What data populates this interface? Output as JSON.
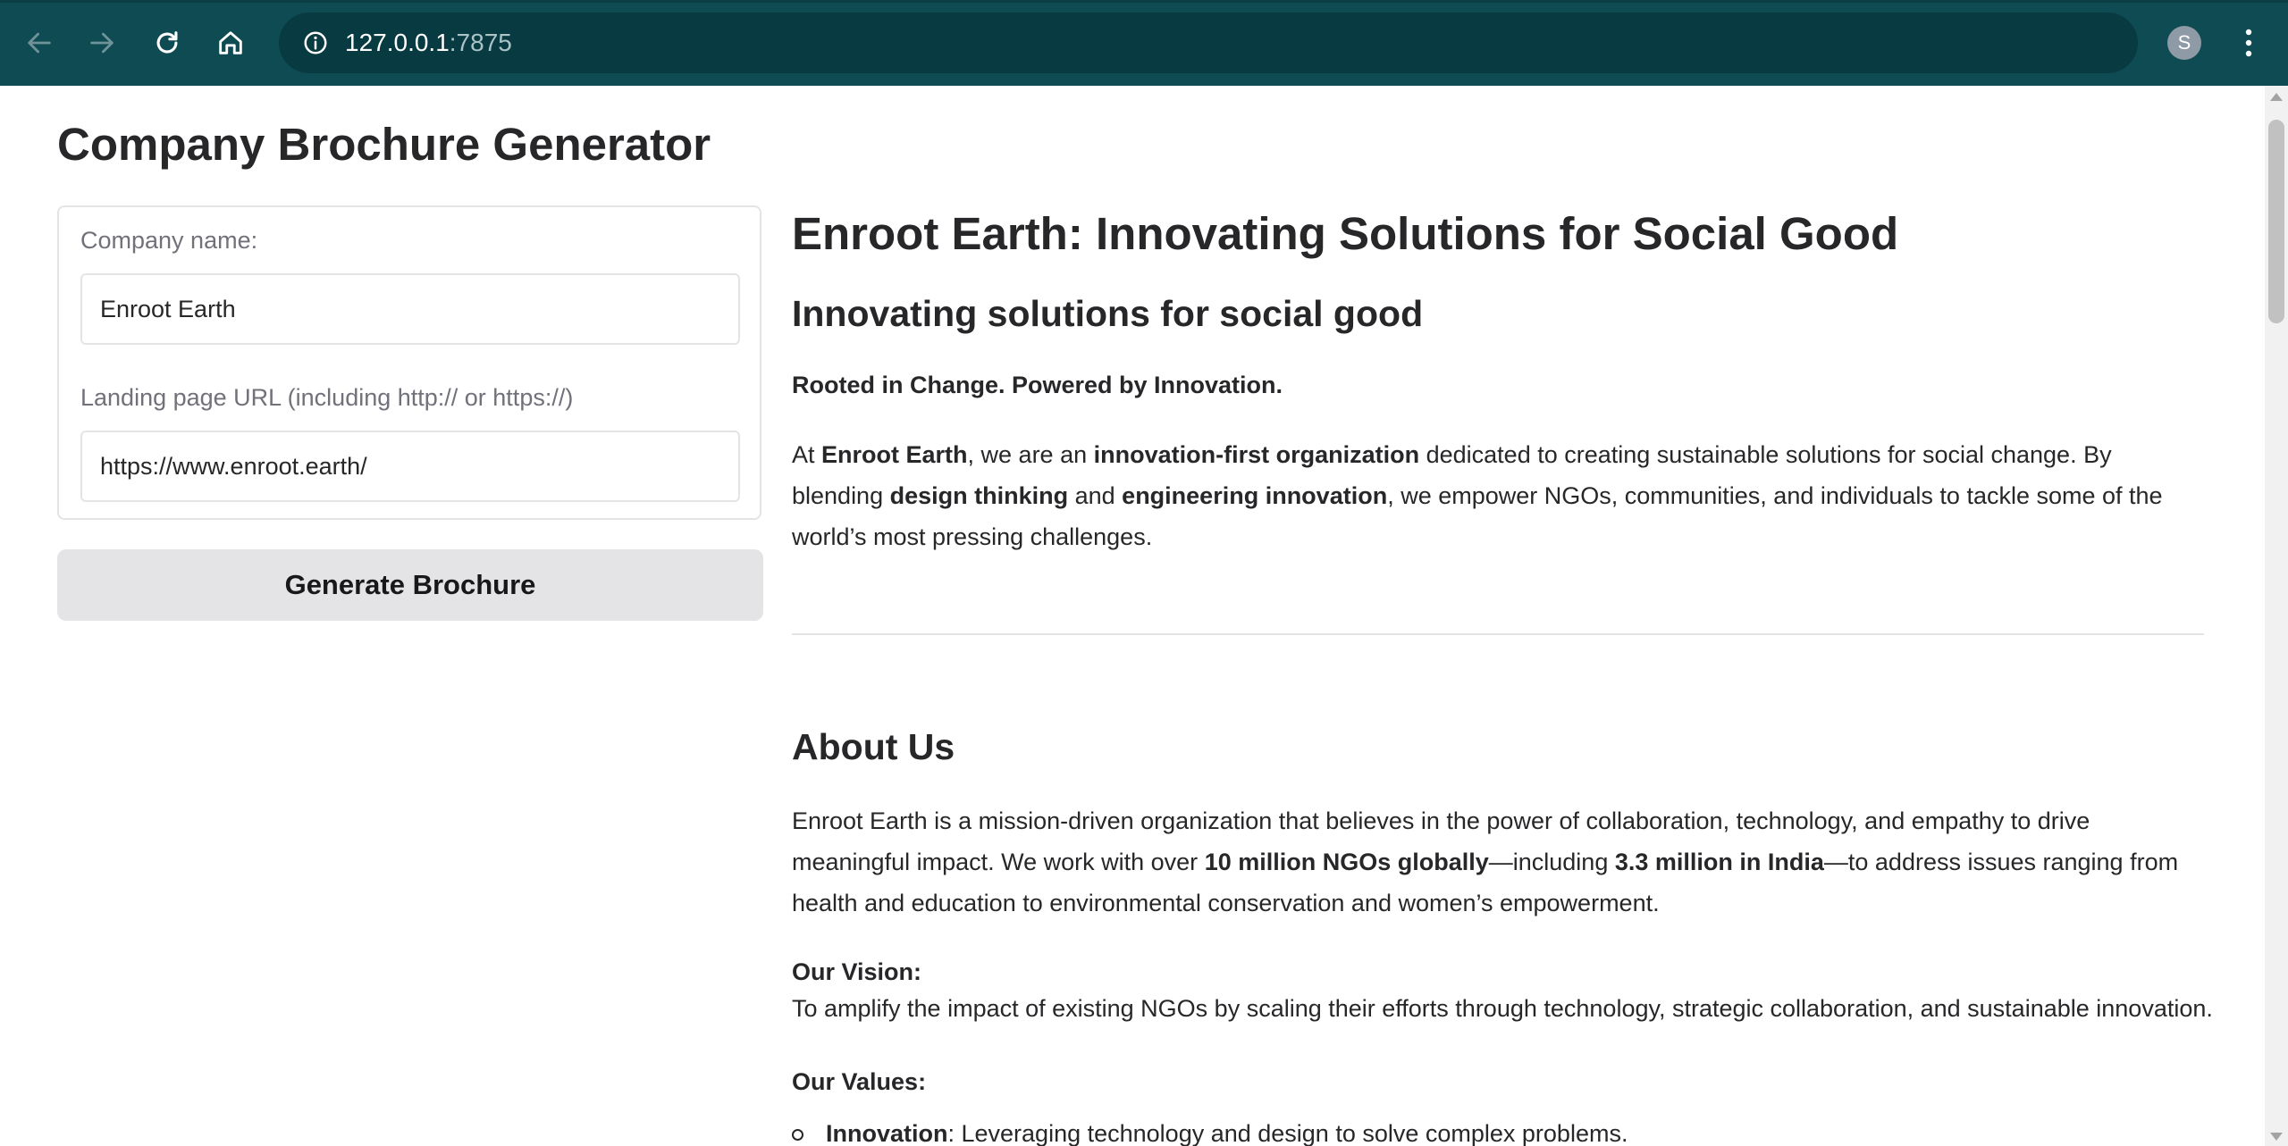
{
  "browser": {
    "url_host": "127.0.0.1",
    "url_port": ":7875",
    "profile_initial": "S",
    "colors": {
      "chrome": "#0e4b53",
      "omnibox": "#083a41"
    },
    "icons": [
      "back-arrow-icon",
      "forward-arrow-icon",
      "reload-icon",
      "home-icon",
      "site-info-icon",
      "bookmark-star-icon",
      "kebab-menu-icon"
    ]
  },
  "app": {
    "title": "Company Brochure Generator",
    "company_name_label": "Company name:",
    "company_name_value": "Enroot Earth",
    "url_label": "Landing page URL (including http:// or https://)",
    "url_value": "https://www.enroot.earth/",
    "generate_button": "Generate Brochure"
  },
  "brochure": {
    "h1": "Enroot Earth: Innovating Solutions for Social Good",
    "h2": "Innovating solutions for social good",
    "tagline": "Rooted in Change. Powered by Innovation.",
    "intro": {
      "t1": "At ",
      "b1": "Enroot Earth",
      "t2": ", we are an ",
      "b2": "innovation-first organization",
      "t3": " dedicated to creating sustainable solutions for social change. By blending ",
      "b3": "design thinking",
      "t4": " and ",
      "b4": "engineering innovation",
      "t5": ", we empower NGOs, communities, and individuals to tackle some of the world’s most pressing challenges."
    },
    "about_heading": "About Us",
    "about": {
      "t1": "Enroot Earth is a mission-driven organization that believes in the power of collaboration, technology, and empathy to drive meaningful impact. We work with over ",
      "b1": "10 million NGOs globally",
      "t2": "—including ",
      "b2": "3.3 million in India",
      "t3": "—to address issues ranging from health and education to environmental conservation and women’s empowerment."
    },
    "vision_label": "Our Vision:",
    "vision_text": "To amplify the impact of existing NGOs by scaling their efforts through technology, strategic collaboration, and sustainable innovation.",
    "values_label": "Our Values:",
    "values": [
      {
        "term": "Innovation",
        "text": ": Leveraging technology and design to solve complex problems."
      }
    ]
  }
}
